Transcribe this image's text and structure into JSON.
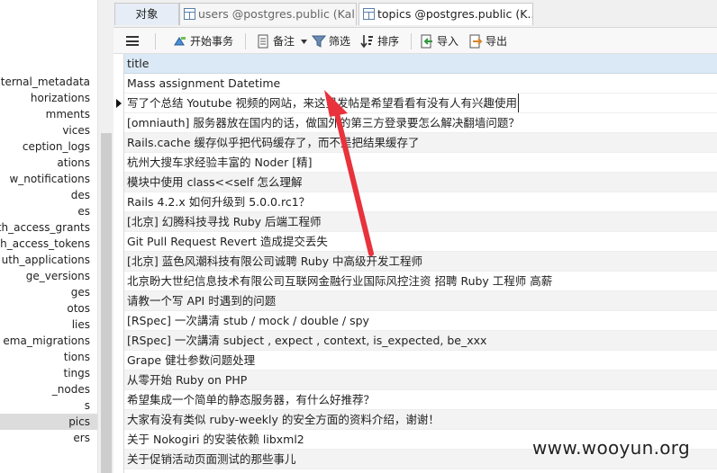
{
  "tree": {
    "items": [
      {
        "label": "internal_metadata"
      },
      {
        "label": "horizations"
      },
      {
        "label": "mments"
      },
      {
        "label": "vices"
      },
      {
        "label": "ception_logs"
      },
      {
        "label": "ations"
      },
      {
        "label": "w_notifications"
      },
      {
        "label": "des"
      },
      {
        "label": "es"
      },
      {
        "label": "uth_access_grants"
      },
      {
        "label": "uth_access_tokens"
      },
      {
        "label": "uth_applications"
      },
      {
        "label": "ge_versions"
      },
      {
        "label": "ges"
      },
      {
        "label": "otos"
      },
      {
        "label": "lies"
      },
      {
        "label": "ema_migrations"
      },
      {
        "label": "tions"
      },
      {
        "label": "tings"
      },
      {
        "label": "_nodes"
      },
      {
        "label": "s"
      },
      {
        "label": "pics"
      },
      {
        "label": "ers"
      }
    ],
    "selected_index": 21
  },
  "tabs": {
    "objects": "对象",
    "users": "users @postgres.public (Kal...",
    "topics": "topics @postgres.public (K..."
  },
  "toolbar": {
    "begin_transaction": "开始事务",
    "memo": "备注",
    "filter": "筛选",
    "sort": "排序",
    "import": "导入",
    "export": "导出"
  },
  "grid": {
    "column_header": "title",
    "current_row_index": 1,
    "rows": [
      "Mass assignment Datetime",
      "写了个总结 Youtube 视频的网站，来这里发帖是希望看看有没有人有兴趣使用",
      "[omniauth] 服务器放在国内的话，做国外的第三方登录要怎么解决翻墙问题？",
      "Rails.cache 缓存似乎把代码缓存了，而不是把结果缓存了",
      "杭州大搜车求经验丰富的 Noder [精]",
      "模块中使用 class<<self 怎么理解",
      "Rails 4.2.x 如何升级到 5.0.0.rc1？",
      "[北京] 幻腾科技寻找 Ruby 后端工程师",
      "Git Pull Request Revert 造成提交丢失",
      "[北京] 蓝色风潮科技有限公司诚聘 Ruby 中高级开发工程师",
      "北京盼大世纪信息技术有限公司互联网金融行业国际风控注资 招聘 Ruby 工程师 高薪",
      "请教一个写 API 时遇到的问题",
      "[RSpec] 一次講清 stub / mock / double / spy",
      "[RSpec] 一次講清 subject , expect , context, is_expected, be_xxx",
      "Grape 健壮参数问题处理",
      "从零开始 Ruby on PHP",
      "希望集成一个简单的静态服务器，有什么好推荐？",
      "大家有没有类似 ruby-weekly 的安全方面的资料介绍，谢谢！",
      "关于 Nokogiri 的安装依赖 libxml2",
      "关于促销活动页面测试的那些事儿"
    ]
  },
  "watermark": "www.wooyun.org",
  "colors": {
    "header_bg": "#dbe8f5",
    "alt_row_bg": "#f3f3f3",
    "arrow": "#e8323c"
  }
}
